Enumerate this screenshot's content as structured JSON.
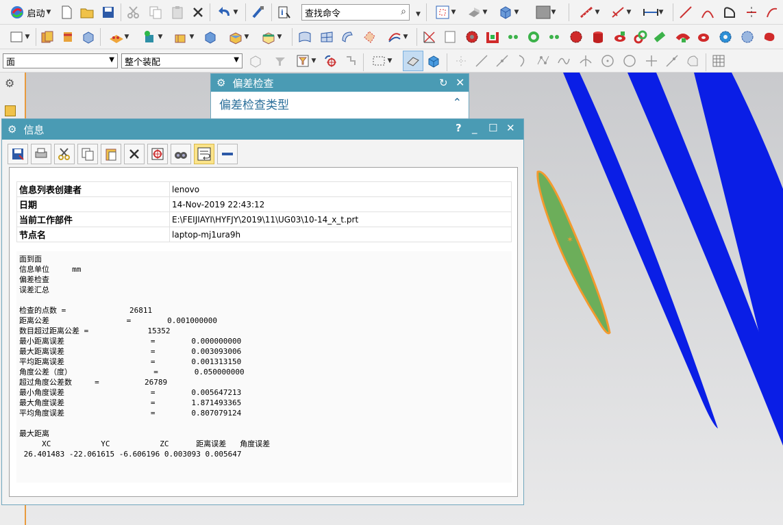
{
  "toolbar": {
    "start_label": "启动",
    "search_placeholder": "查找命令",
    "selection_filter": "面",
    "selection_scope": "整个装配"
  },
  "deviation_dialog": {
    "title": "偏差检查",
    "section_label": "偏差检查类型"
  },
  "info_window": {
    "title": "信息",
    "help_label": "?",
    "meta": [
      {
        "key": "信息列表创建者",
        "value": "lenovo"
      },
      {
        "key": "日期",
        "value": "14-Nov-2019 22:43:12"
      },
      {
        "key": "当前工作部件",
        "value": "E:\\FEIJIAYI\\HYFJY\\2019\\11\\UG03\\10-14_x_t.prt"
      },
      {
        "key": "节点名",
        "value": "laptop-mj1ura9h"
      }
    ],
    "report": [
      "面到面",
      "信息单位     mm",
      "偏差检查",
      "误差汇总",
      "",
      "检查的点数 =              26811",
      "距离公差                 =        0.001000000",
      "数目超过距离公差 =             15352",
      "最小距离误差                   =        0.000000000",
      "最大距离误差                   =        0.003093006",
      "平均距离误差                   =        0.001313150",
      "角度公差（度）                  =        0.050000000",
      "超过角度公差数     =          26789",
      "最小角度误差                   =        0.005647213",
      "最大角度误差                   =        1.871493365",
      "平均角度误差                   =        0.807079124",
      "",
      "最大距离",
      "     XC           YC           ZC      距离误差   角度误差",
      " 26.401483 -22.061615 -6.606196 0.003093 0.005647"
    ]
  },
  "colors": {
    "title_bar": "#4a9bb4",
    "body_blue": "#0a1ee6",
    "selected_body": "#6cae5a",
    "highlight_edge": "#f39a2e"
  }
}
